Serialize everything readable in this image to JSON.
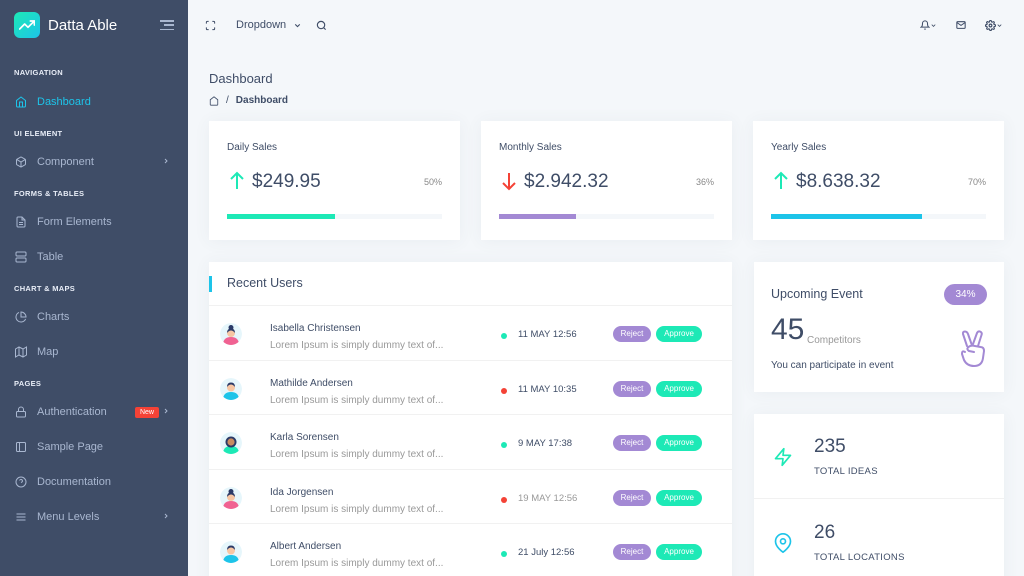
{
  "app": {
    "name": "Datta Able",
    "accent": "#1dc4e9",
    "sidebar_bg": "#3f4d67"
  },
  "sidebar": {
    "sections": [
      {
        "caption": "NAVIGATION",
        "items": [
          {
            "label": "Dashboard",
            "icon": "home-icon",
            "active": true
          }
        ]
      },
      {
        "caption": "UI ELEMENT",
        "items": [
          {
            "label": "Component",
            "icon": "box-icon",
            "has_arrow": true
          }
        ]
      },
      {
        "caption": "FORMS & TABLES",
        "items": [
          {
            "label": "Form Elements",
            "icon": "file-text-icon"
          },
          {
            "label": "Table",
            "icon": "server-icon"
          }
        ]
      },
      {
        "caption": "CHART & MAPS",
        "items": [
          {
            "label": "Charts",
            "icon": "pie-chart-icon"
          },
          {
            "label": "Map",
            "icon": "map-icon"
          }
        ]
      },
      {
        "caption": "PAGES",
        "items": [
          {
            "label": "Authentication",
            "icon": "lock-icon",
            "badge": "New",
            "has_arrow": true
          },
          {
            "label": "Sample Page",
            "icon": "sidebar-icon"
          },
          {
            "label": "Documentation",
            "icon": "help-circle-icon"
          },
          {
            "label": "Menu Levels",
            "icon": "menu-icon",
            "has_arrow": true
          }
        ]
      }
    ]
  },
  "topbar": {
    "dropdown_label": "Dropdown"
  },
  "page": {
    "title": "Dashboard",
    "breadcrumb": "Dashboard"
  },
  "sales": [
    {
      "title": "Daily Sales",
      "value": "$249.95",
      "percent_label": "50%",
      "progress": 0.5,
      "trend": "up",
      "color": "#1de9b6"
    },
    {
      "title": "Monthly Sales",
      "value": "$2.942.32",
      "percent_label": "36%",
      "progress": 0.36,
      "trend": "down",
      "color": "#a389d4"
    },
    {
      "title": "Yearly Sales",
      "value": "$8.638.32",
      "percent_label": "70%",
      "progress": 0.7,
      "trend": "up",
      "color": "#1dc4e9"
    }
  ],
  "recent_users": {
    "title": "Recent Users",
    "reject_label": "Reject",
    "approve_label": "Approve",
    "rows": [
      {
        "name": "Isabella Christensen",
        "desc": "Lorem Ipsum is simply dummy text of...",
        "date": "11 MAY 12:56",
        "status": "green",
        "muted": false,
        "avatar": "female"
      },
      {
        "name": "Mathilde Andersen",
        "desc": "Lorem Ipsum is simply dummy text of...",
        "date": "11 MAY 10:35",
        "status": "red",
        "muted": false,
        "avatar": "male"
      },
      {
        "name": "Karla Sorensen",
        "desc": "Lorem Ipsum is simply dummy text of...",
        "date": "9 MAY 17:38",
        "status": "green",
        "muted": false,
        "avatar": "female-dark"
      },
      {
        "name": "Ida Jorgensen",
        "desc": "Lorem Ipsum is simply dummy text of...",
        "date": "19 MAY 12:56",
        "status": "red",
        "muted": true,
        "avatar": "female"
      },
      {
        "name": "Albert Andersen",
        "desc": "Lorem Ipsum is simply dummy text of...",
        "date": "21 July 12:56",
        "status": "green",
        "muted": false,
        "avatar": "male"
      }
    ]
  },
  "upcoming_event": {
    "title": "Upcoming Event",
    "badge": "34%",
    "count": "45",
    "count_label": "Competitors",
    "note": "You can participate in event"
  },
  "stats": [
    {
      "value": "235",
      "label": "TOTAL IDEAS",
      "icon": "zap-icon"
    },
    {
      "value": "26",
      "label": "TOTAL LOCATIONS",
      "icon": "map-pin-icon"
    }
  ]
}
